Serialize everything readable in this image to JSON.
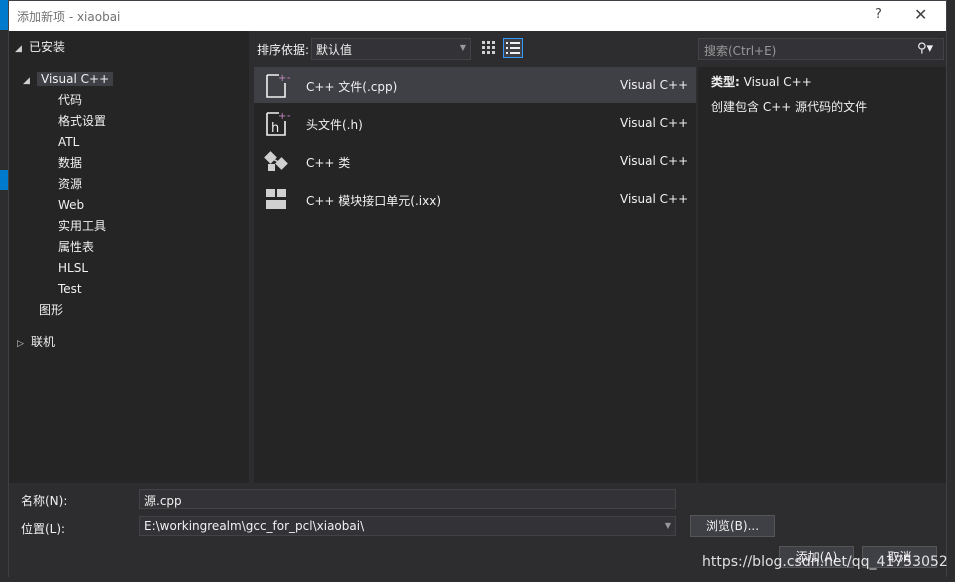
{
  "window": {
    "title": "添加新项 - xiaobai",
    "help": "?",
    "close": "✕"
  },
  "tree": {
    "installed": "已安装",
    "visual_cpp": "Visual C++",
    "children": [
      "代码",
      "格式设置",
      "ATL",
      "数据",
      "资源",
      "Web",
      "实用工具",
      "属性表",
      "HLSL",
      "Test"
    ],
    "graphics": "图形",
    "online": "联机"
  },
  "toolbar": {
    "sort_label": "排序依据:",
    "sort_value": "默认值"
  },
  "search": {
    "placeholder": "搜索(Ctrl+E)"
  },
  "templates": [
    {
      "name": "C++ 文件(.cpp)",
      "lang": "Visual C++",
      "icon": "cpp-file-icon"
    },
    {
      "name": "头文件(.h)",
      "lang": "Visual C++",
      "icon": "header-file-icon"
    },
    {
      "name": "C++ 类",
      "lang": "Visual C++",
      "icon": "cpp-class-icon"
    },
    {
      "name": "C++ 模块接口单元(.ixx)",
      "lang": "Visual C++",
      "icon": "module-unit-icon"
    }
  ],
  "details": {
    "type_label": "类型:",
    "type_value": "Visual C++",
    "description": "创建包含 C++ 源代码的文件"
  },
  "form": {
    "name_label": "名称(N):",
    "name_value": "源.cpp",
    "location_label": "位置(L):",
    "location_value": "E:\\workingrealm\\gcc_for_pcl\\xiaobai\\",
    "browse": "浏览(B)...",
    "add": "添加(A)",
    "cancel": "取消"
  },
  "watermark": "https://blog.csdn.net/qq_41753052",
  "colors": {
    "accent": "#007acc",
    "selection": "#3f3f46",
    "panel": "#252526",
    "background": "#2d2d30"
  }
}
